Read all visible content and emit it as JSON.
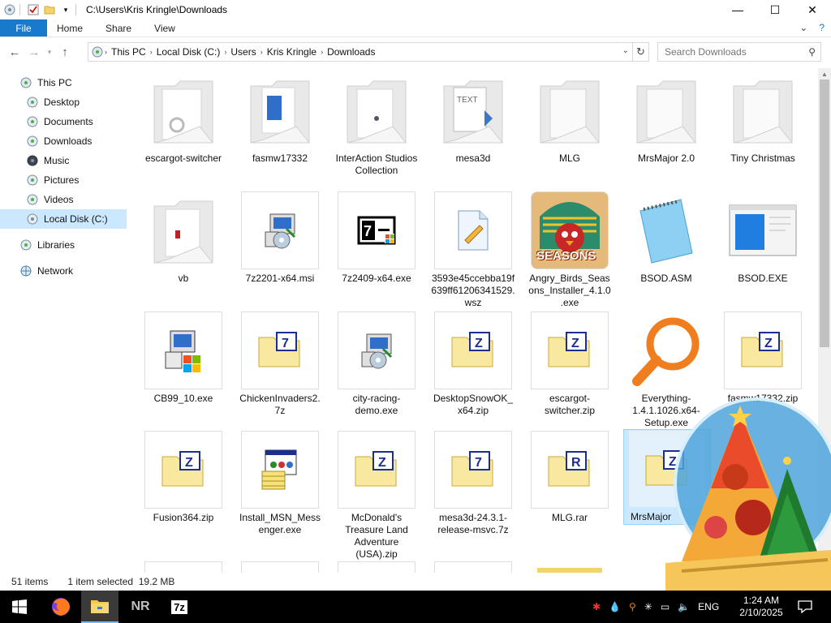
{
  "window": {
    "title": "C:\\Users\\Kris Kringle\\Downloads",
    "controls": {
      "minimize": "—",
      "maximize": "☐",
      "close": "✕"
    }
  },
  "ribbon": {
    "file_tab": "File",
    "tabs": [
      "Home",
      "Share",
      "View"
    ],
    "expand": "⌄",
    "help": "?"
  },
  "address": {
    "breadcrumbs": [
      "This PC",
      "Local Disk (C:)",
      "Users",
      "Kris Kringle",
      "Downloads"
    ],
    "search_placeholder": "Search Downloads"
  },
  "nav_pane": {
    "items": [
      {
        "label": "This PC",
        "icon": "computer-icon"
      },
      {
        "label": "Desktop",
        "icon": "desktop-icon"
      },
      {
        "label": "Documents",
        "icon": "documents-icon"
      },
      {
        "label": "Downloads",
        "icon": "downloads-icon"
      },
      {
        "label": "Music",
        "icon": "music-icon"
      },
      {
        "label": "Pictures",
        "icon": "pictures-icon"
      },
      {
        "label": "Videos",
        "icon": "videos-icon"
      },
      {
        "label": "Local Disk (C:)",
        "icon": "drive-icon",
        "selected": true
      },
      {
        "label": "Libraries",
        "icon": "libraries-icon"
      },
      {
        "label": "Network",
        "icon": "network-icon"
      }
    ]
  },
  "files": [
    {
      "label": "escargot-switcher",
      "type": "folder"
    },
    {
      "label": "fasmw17332",
      "type": "folder"
    },
    {
      "label": "InterAction Studios Collection",
      "type": "folder"
    },
    {
      "label": "mesa3d",
      "type": "folder"
    },
    {
      "label": "MLG",
      "type": "folder"
    },
    {
      "label": "MrsMajor 2.0",
      "type": "folder"
    },
    {
      "label": "Tiny Christmas",
      "type": "folder"
    },
    {
      "label": "vb",
      "type": "folder"
    },
    {
      "label": "7z2201-x64.msi",
      "type": "installer"
    },
    {
      "label": "7z2409-x64.exe",
      "type": "sevenzip-exe"
    },
    {
      "label": "3593e45ccebba19f639ff61206341529.wsz",
      "type": "wsz"
    },
    {
      "label": "Angry_Birds_Seasons_Installer_4.1.0.exe",
      "type": "angry-birds",
      "badge": "SEASONS"
    },
    {
      "label": "BSOD.ASM",
      "type": "notepad"
    },
    {
      "label": "BSOD.EXE",
      "type": "window-exe"
    },
    {
      "label": "CB99_10.exe",
      "type": "setup"
    },
    {
      "label": "ChickenInvaders2.7z",
      "type": "archive",
      "letter": "7"
    },
    {
      "label": "city-racing-demo.exe",
      "type": "installer"
    },
    {
      "label": "DesktopSnowOK_x64.zip",
      "type": "archive",
      "letter": "Z"
    },
    {
      "label": "escargot-switcher.zip",
      "type": "archive",
      "letter": "Z"
    },
    {
      "label": "Everything-1.4.1.1026.x64-Setup.exe",
      "type": "everything"
    },
    {
      "label": "fasmw17332.zip",
      "type": "archive",
      "letter": "Z"
    },
    {
      "label": "Fusion364.zip",
      "type": "archive",
      "letter": "Z"
    },
    {
      "label": "Install_MSN_Messenger.exe",
      "type": "msn-setup"
    },
    {
      "label": "McDonald's Treasure Land Adventure (USA).zip",
      "type": "archive",
      "letter": "Z"
    },
    {
      "label": "mesa3d-24.3.1-release-msvc.7z",
      "type": "archive",
      "letter": "7"
    },
    {
      "label": "MLG.rar",
      "type": "archive",
      "letter": "R"
    },
    {
      "label": "MrsMajor",
      "type": "archive",
      "letter": "Z",
      "selected": true
    }
  ],
  "status_bar": {
    "count": "51 items",
    "selection": "1 item selected  19.2 MB"
  },
  "taskbar": {
    "apps": [
      {
        "name": "firefox-icon"
      },
      {
        "name": "file-explorer-icon"
      },
      {
        "name": "nr-app",
        "text": "NR"
      },
      {
        "name": "sevenzip-app",
        "text": "7z"
      }
    ],
    "tray": {
      "language": "ENG",
      "time": "1:24 AM",
      "date": "2/10/2025"
    }
  },
  "colors": {
    "accent": "#1979ca",
    "selection": "#cce8ff",
    "folder": "#f3f3f3",
    "archive": "#f9e9a0"
  }
}
